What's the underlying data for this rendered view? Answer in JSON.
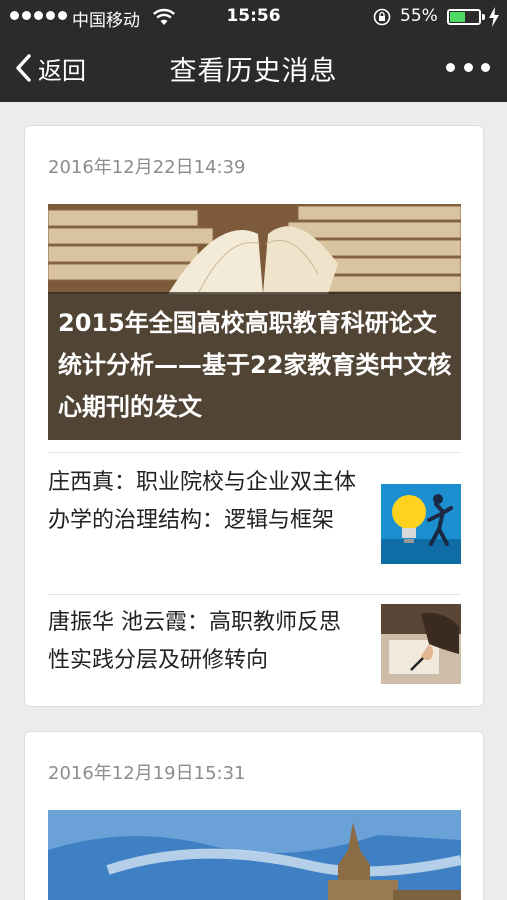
{
  "status_bar": {
    "carrier": "中国移动",
    "time": "15:56",
    "battery_percent": "55%",
    "battery_level": 0.55,
    "battery_color": "#4cd964"
  },
  "nav": {
    "back_label": "返回",
    "title": "查看历史消息",
    "back_icon": "chevron-left-icon",
    "more_icon": "more-dots-icon"
  },
  "messages": [
    {
      "date": "2016年12月22日14:39",
      "cover_title": "2015年全国高校高职教育科研论文统计分析——基于22家教育类中文核心期刊的发文",
      "items": [
        {
          "title": "庄西真：职业院校与企业双主体办学的治理结构：逻辑与框架"
        },
        {
          "title": "唐振华 池云霞：高职教师反思性实践分层及研修转向"
        }
      ]
    },
    {
      "date": "2016年12月19日15:31"
    }
  ],
  "colors": {
    "nav_bg": "#2b2b2c",
    "page_bg": "#ececec",
    "date_text": "#8c8c8c"
  }
}
